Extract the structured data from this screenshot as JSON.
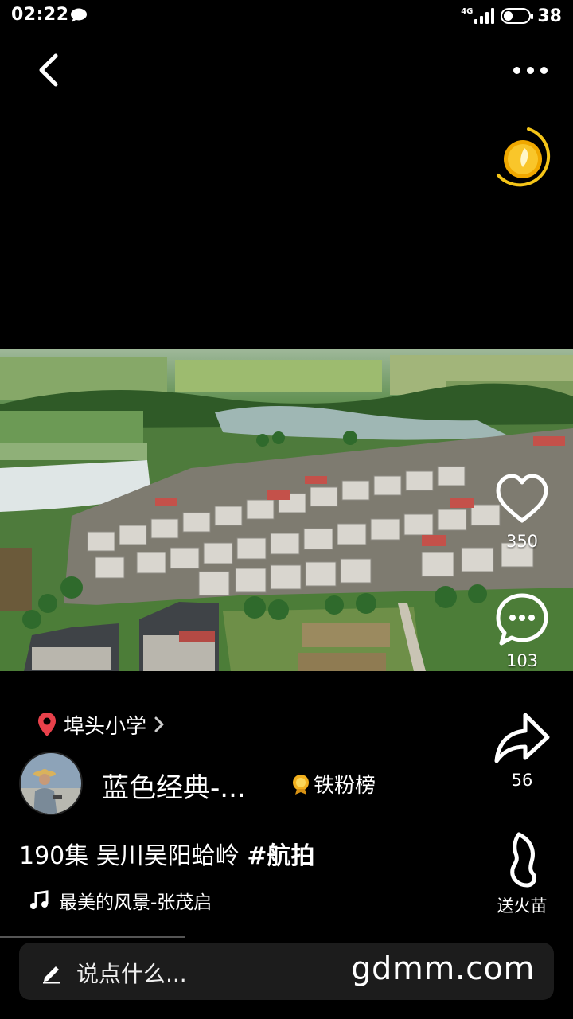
{
  "status_bar": {
    "time": "02:22",
    "network": "4G",
    "battery": "38",
    "battery_level": 0.38
  },
  "video": {
    "description_icon": "aerial-village-photo"
  },
  "actions": {
    "like_count": "350",
    "comment_count": "103",
    "share_count": "56",
    "gift_label": "送火苗"
  },
  "location": {
    "name": "埠头小学"
  },
  "author": {
    "name": "蓝色经典-...",
    "badge": "铁粉榜"
  },
  "post": {
    "caption_text": "190集 吴川吴阳蛤岭 ",
    "hashtag": "#航拍"
  },
  "music": {
    "title": "最美的风景-张茂启"
  },
  "comment_bar": {
    "placeholder": "说点什么...",
    "watermark": "gdmm.com"
  },
  "colors": {
    "background": "#000000",
    "pin": "#e8414b",
    "coin": "#f5c518",
    "comment_bar": "#1c1c1c"
  }
}
